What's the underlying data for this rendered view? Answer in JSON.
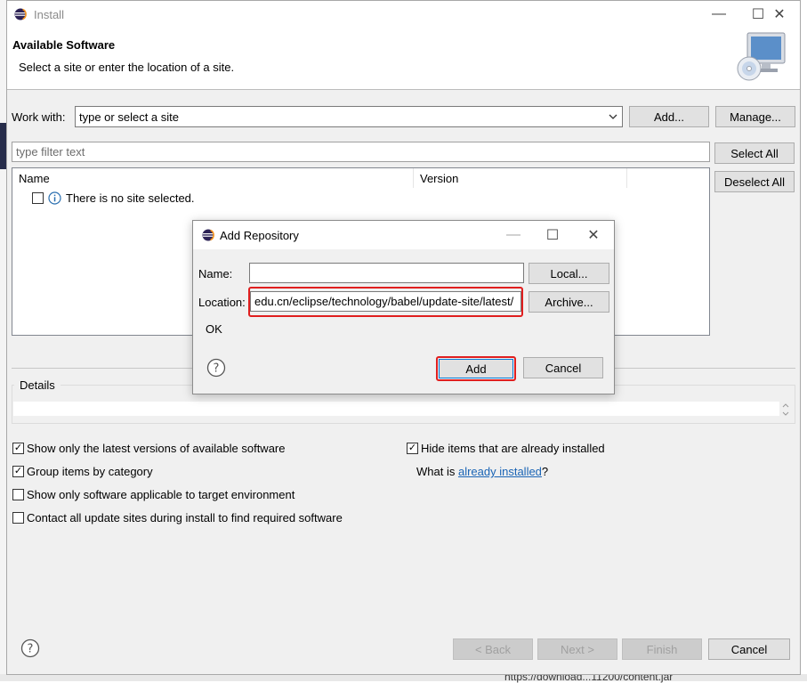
{
  "window": {
    "title": "Install",
    "controls": {
      "minimize": "—",
      "maximize": "☐",
      "close": "✕"
    }
  },
  "header": {
    "title": "Available Software",
    "description": "Select a site or enter the location of a site."
  },
  "work_with": {
    "label": "Work with:",
    "placeholder": "type or select a site",
    "add_label": "Add...",
    "manage_label": "Manage..."
  },
  "filter": {
    "placeholder": "type filter text",
    "select_all_label": "Select All",
    "deselect_all_label": "Deselect All"
  },
  "table": {
    "columns": [
      "Name",
      "Version"
    ],
    "rows": [
      {
        "name": "There is no site selected.",
        "checked": false
      }
    ]
  },
  "details": {
    "label": "Details"
  },
  "options": {
    "left": [
      {
        "label": "Show only the latest versions of available software",
        "checked": true
      },
      {
        "label": "Group items by category",
        "checked": true
      },
      {
        "label": "Show only software applicable to target environment",
        "checked": false
      },
      {
        "label": "Contact all update sites during install to find required software",
        "checked": false
      }
    ],
    "hide_installed": {
      "label": "Hide items that are already installed",
      "checked": true
    },
    "what_is": {
      "prefix": "What is ",
      "link": "already installed",
      "suffix": "?"
    }
  },
  "footer": {
    "back_label": "< Back",
    "next_label": "Next >",
    "finish_label": "Finish",
    "cancel_label": "Cancel"
  },
  "status_strip": {
    "text": "https://download...11200/content.jar"
  },
  "dialog": {
    "title": "Add Repository",
    "name_label": "Name:",
    "name_value": "",
    "location_label": "Location:",
    "location_value": "edu.cn/eclipse/technology/babel/update-site/latest/",
    "local_label": "Local...",
    "archive_label": "Archive...",
    "status": "OK",
    "add_label": "Add",
    "cancel_label": "Cancel"
  },
  "colors": {
    "highlight": "#e01f1f",
    "link": "#1a64b5",
    "focus": "#0078d7"
  }
}
